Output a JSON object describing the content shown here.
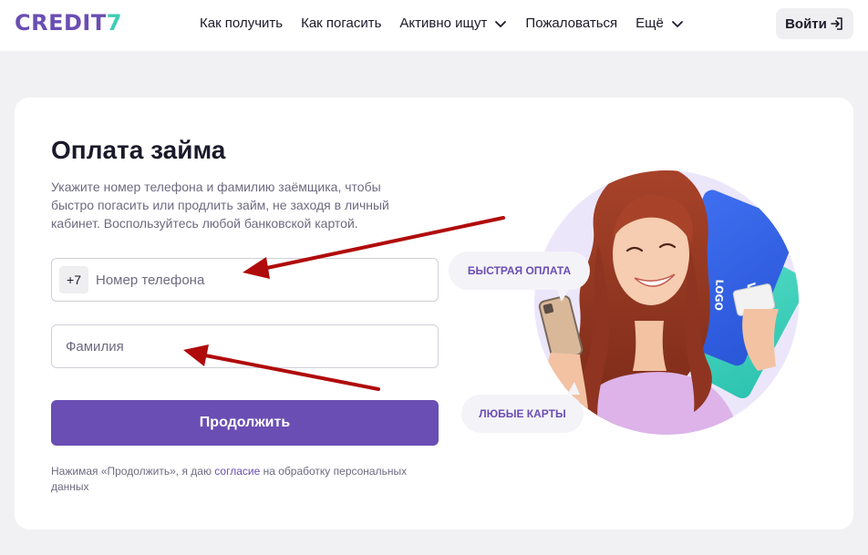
{
  "header": {
    "logo_text": "CREDIT",
    "logo_digit": "7",
    "nav": [
      {
        "label": "Как получить",
        "dropdown": false
      },
      {
        "label": "Как погасить",
        "dropdown": false
      },
      {
        "label": "Активно ищут",
        "dropdown": true
      },
      {
        "label": "Пожаловаться",
        "dropdown": false
      },
      {
        "label": "Ещё",
        "dropdown": true
      }
    ],
    "login_label": "Войти"
  },
  "form": {
    "title": "Оплата займа",
    "description": "Укажите номер телефона и фамилию заёмщика, чтобы быстро погасить или продлить займ, не заходя в личный кабинет. Воспользуйтесь любой банковской картой.",
    "phone_prefix": "+7",
    "phone_placeholder": "Номер телефона",
    "surname_placeholder": "Фамилия",
    "submit_label": "Продолжить",
    "consent_before": "Нажимая «Продолжить», я даю ",
    "consent_link": "согласие",
    "consent_after": " на обработку персональных данных"
  },
  "hero": {
    "badge_fast": "БЫСТРАЯ ОПЛАТА",
    "badge_cards": "ЛЮБЫЕ КАРТЫ",
    "card_brand": "VISA",
    "card_text": "LOGO"
  },
  "colors": {
    "brand_purple": "#6a4eb3",
    "brand_teal": "#3ccdb3",
    "annotation_arrow": "#b00b0b",
    "hero_circle": "#ece6fb"
  }
}
